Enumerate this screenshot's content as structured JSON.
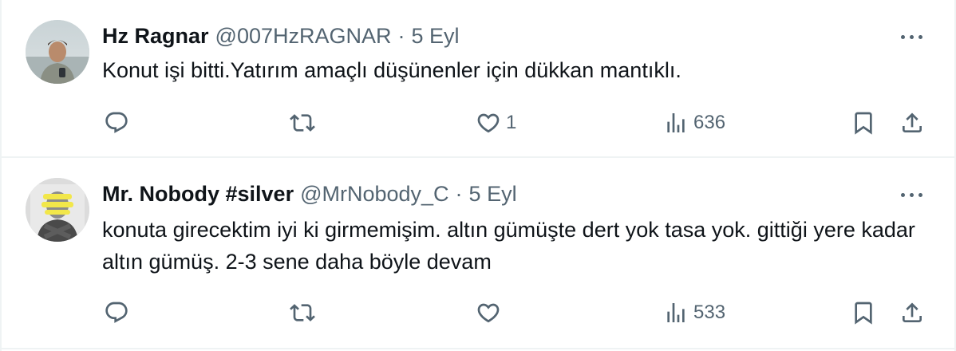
{
  "tweets": [
    {
      "name": "Hz Ragnar",
      "handle": "@007HzRAGNAR",
      "separator": "·",
      "time": "5 Eyl",
      "text": "Konut işi bitti.Yatırım amaçlı düşünenler için dükkan mantıklı.",
      "likes": "1",
      "views": "636",
      "avatar_icon": "photo-avatar"
    },
    {
      "name": "Mr. Nobody #silver",
      "handle": "@MrNobody_C",
      "separator": "·",
      "time": "5 Eyl",
      "text": "konuta girecektim iyi ki girmemişim. altın gümüşte dert yok tasa yok. gittiği yere kadar altın gümüş. 2-3 sene daha böyle devam",
      "likes": "",
      "views": "533",
      "avatar_icon": "photo-avatar"
    }
  ],
  "icons": {
    "reply": "reply-icon",
    "retweet": "retweet-icon",
    "like": "heart-icon",
    "views": "views-icon",
    "bookmark": "bookmark-icon",
    "share": "share-icon",
    "more": "more-icon"
  },
  "colors": {
    "text": "#0f1419",
    "secondary": "#536471",
    "divider": "#eff3f4"
  }
}
